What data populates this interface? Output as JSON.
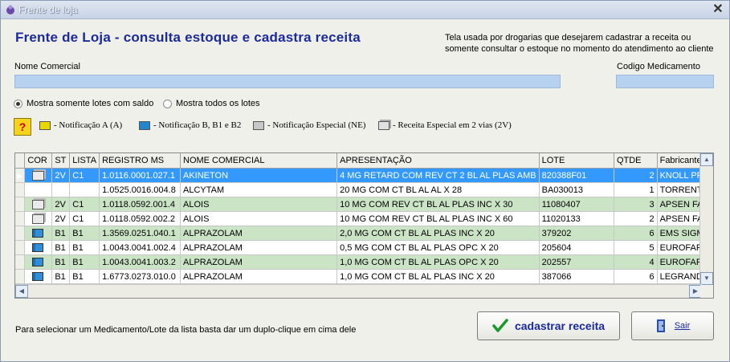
{
  "window": {
    "title": "Frente de loja",
    "close_label": "✕"
  },
  "heading": "Frente de Loja - consulta estoque e cadastra receita",
  "description": "Tela usada por drogarias que desejarem cadastrar a receita ou somente consultar o estoque no momento do atendimento ao cliente",
  "fields": {
    "nome_comercial_label": "Nome Comercial",
    "nome_comercial_value": "",
    "codigo_label": "Codigo Medicamento",
    "codigo_value": ""
  },
  "radios": [
    {
      "label": "Mostra somente lotes com saldo",
      "checked": true
    },
    {
      "label": "Mostra todos os lotes",
      "checked": false
    }
  ],
  "legend": {
    "help": "?",
    "items": [
      {
        "label": "- Notificação A (A)",
        "icon": "yellow-book-icon",
        "color": "#e8d800"
      },
      {
        "label": "- Notificação B, B1 e B2",
        "icon": "blue-book-icon",
        "color": "#1f86d0"
      },
      {
        "label": "- Notificação Especial (NE)",
        "icon": "gray-book-icon",
        "color": "#c8c8c8"
      },
      {
        "label": "- Receita Especial em 2 vias (2V)",
        "icon": "two-copies-icon",
        "color": "#c8c8c8"
      }
    ]
  },
  "grid": {
    "columns": [
      "COR",
      "ST",
      "LISTA",
      "REGISTRO MS",
      "NOME COMERCIAL",
      "APRESENTAÇÃO",
      "LOTE",
      "QTDE",
      "Fabricante"
    ],
    "rows": [
      {
        "icon": "stack",
        "st": "2V",
        "lista": "C1",
        "registro": "1.0116.0001.027.1",
        "nome": "AKINETON",
        "apresentacao": "4 MG RETARD COM REV CT 2 BL AL PLAS AMB",
        "lote": "820388F01",
        "qtde": "2",
        "fabricante": "KNOLL PR",
        "style": "sel"
      },
      {
        "icon": "",
        "st": "",
        "lista": "",
        "registro": "1.0525.0016.004.8",
        "nome": "ALCYTAM",
        "apresentacao": "20 MG COM CT BL AL AL X 28",
        "lote": "BA030013",
        "qtde": "1",
        "fabricante": "TORRENT",
        "style": "w"
      },
      {
        "icon": "stack",
        "st": "2V",
        "lista": "C1",
        "registro": "1.0118.0592.001.4",
        "nome": "ALOIS",
        "apresentacao": "10 MG COM REV CT BL AL PLAS INC X 30",
        "lote": "11080407",
        "qtde": "3",
        "fabricante": "APSEN FAI",
        "style": "g"
      },
      {
        "icon": "stack",
        "st": "2V",
        "lista": "C1",
        "registro": "1.0118.0592.002.2",
        "nome": "ALOIS",
        "apresentacao": "10 MG COM REV CT BL AL PLAS INC X 60",
        "lote": "11020133",
        "qtde": "2",
        "fabricante": "APSEN FAI",
        "style": "w"
      },
      {
        "icon": "blue",
        "st": "B1",
        "lista": "B1",
        "registro": "1.3569.0251.040.1",
        "nome": "ALPRAZOLAM",
        "apresentacao": "2,0 MG COM CT BL AL PLAS INC X 20",
        "lote": "379202",
        "qtde": "6",
        "fabricante": "EMS SIGMA",
        "style": "g"
      },
      {
        "icon": "blue",
        "st": "B1",
        "lista": "B1",
        "registro": "1.0043.0041.002.4",
        "nome": "ALPRAZOLAM",
        "apresentacao": "0,5 MG COM CT BL AL PLAS OPC X 20",
        "lote": "205604",
        "qtde": "5",
        "fabricante": "EUROFARI",
        "style": "w"
      },
      {
        "icon": "blue",
        "st": "B1",
        "lista": "B1",
        "registro": "1.0043.0041.003.2",
        "nome": "ALPRAZOLAM",
        "apresentacao": "1,0 MG COM CT BL AL PLAS OPC X 20",
        "lote": "202557",
        "qtde": "4",
        "fabricante": "EUROFARI",
        "style": "g"
      },
      {
        "icon": "blue",
        "st": "B1",
        "lista": "B1",
        "registro": "1.6773.0273.010.0",
        "nome": "ALPRAZOLAM",
        "apresentacao": "1,0 MG COM CT BL AL PLAS INC X 20",
        "lote": "387066",
        "qtde": "6",
        "fabricante": "LEGRAND",
        "style": "w"
      }
    ]
  },
  "hint": "Para selecionar um Medicamento/Lote da lista basta dar um duplo-clique em cima dele",
  "buttons": {
    "cadastrar": "cadastrar receita",
    "sair": "Sair"
  }
}
